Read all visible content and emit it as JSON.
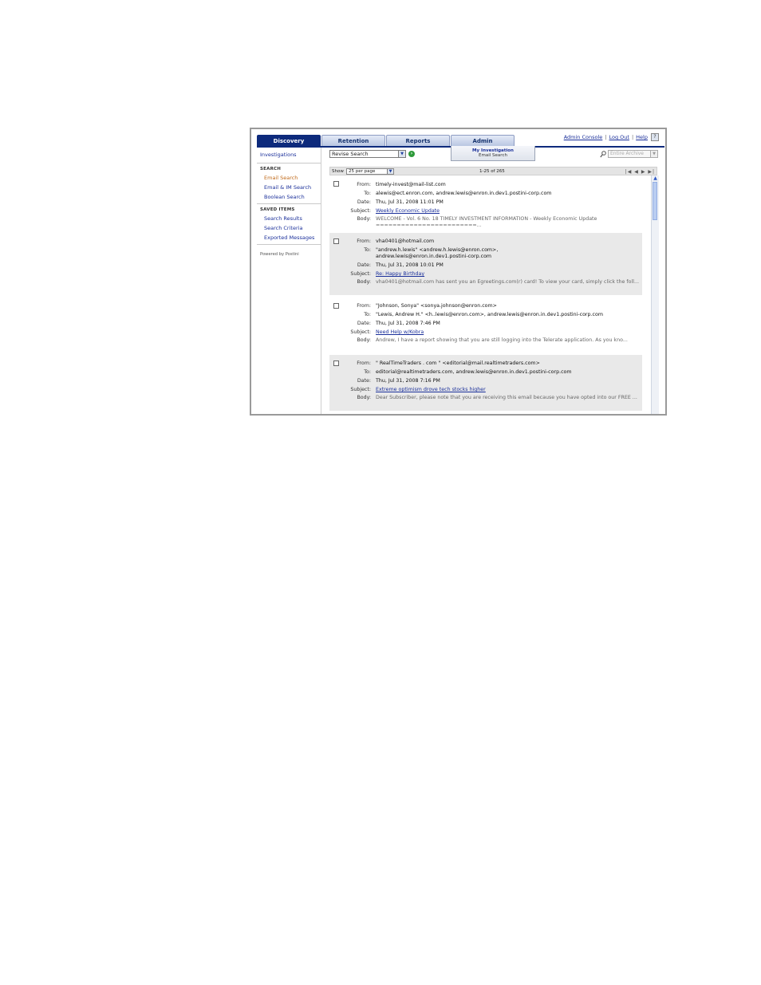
{
  "tabs": [
    {
      "label": "Discovery",
      "active": true
    },
    {
      "label": "Retention",
      "active": false
    },
    {
      "label": "Reports",
      "active": false
    },
    {
      "label": "Admin",
      "active": false
    }
  ],
  "top_links": {
    "admin_console": "Admin Console",
    "log_out": "Log Out",
    "help": "Help",
    "help_icon": "?"
  },
  "sidebar": {
    "investigations": "Investigations",
    "search_heading": "SEARCH",
    "search_items": [
      "Email Search",
      "Email & IM Search",
      "Boolean Search"
    ],
    "saved_heading": "SAVED ITEMS",
    "saved_items": [
      "Search Results",
      "Search Criteria",
      "Exported Messages"
    ],
    "powered": "Powered by Postini"
  },
  "toolbar": {
    "revise_value": "Revise Search",
    "investigation_title": "My Investigation",
    "investigation_sub": "Email Search",
    "scope_value": "Entire Archive"
  },
  "pager": {
    "show_label": "Show",
    "per_page": "25 per page",
    "count": "1-25 of 265",
    "nav": "|◀ ◀ ▶ ▶|"
  },
  "labels": {
    "from": "From:",
    "to": "To:",
    "date": "Date:",
    "subject": "Subject:",
    "body": "Body:"
  },
  "messages": [
    {
      "from": "timely-invest@mail-list.com",
      "to": "alewis@ect.enron.com, andrew.lewis@enron.in.dev1.postini-corp.com",
      "date": "Thu, Jul 31, 2008 11:01 PM",
      "subject": "Weekly Economic Update",
      "body": "WELCOME - Vol. 6 No. 18 TIMELY INVESTMENT INFORMATION - Weekly Economic Update ========================..."
    },
    {
      "from": "vha0401@hotmail.com",
      "to": "\"andrew.h.lewis\" <andrew.h.lewis@enron.com>, andrew.lewis@enron.in.dev1.postini-corp.com",
      "date": "Thu, Jul 31, 2008 10:01 PM",
      "subject": "Re: Happy Birthday",
      "body": "vha0401@hotmail.com has sent you an Egreetings.com(r) card! To view your card, simply click the foll..."
    },
    {
      "from": "\"Johnson, Sonya\" <sonya.johnson@enron.com>",
      "to": "\"Lewis, Andrew H.\" <h..lewis@enron.com>, andrew.lewis@enron.in.dev1.postini-corp.com",
      "date": "Thu, Jul 31, 2008 7:46 PM",
      "subject": "Need Help w/Kobra",
      "body": "Andrew, I have a report showing that you are still logging into the Telerate application. As you kno..."
    },
    {
      "from": "\" RealTimeTraders . com \" <editorial@mail.realtimetraders.com>",
      "to": "editorial@realtimetraders.com, andrew.lewis@enron.in.dev1.postini-corp.com",
      "date": "Thu, Jul 31, 2008 7:16 PM",
      "subject": "Extreme optimism drove tech stocks higher",
      "body": "Dear Subscriber, please note that you are receiving this email because you have opted into our FREE ..."
    }
  ]
}
